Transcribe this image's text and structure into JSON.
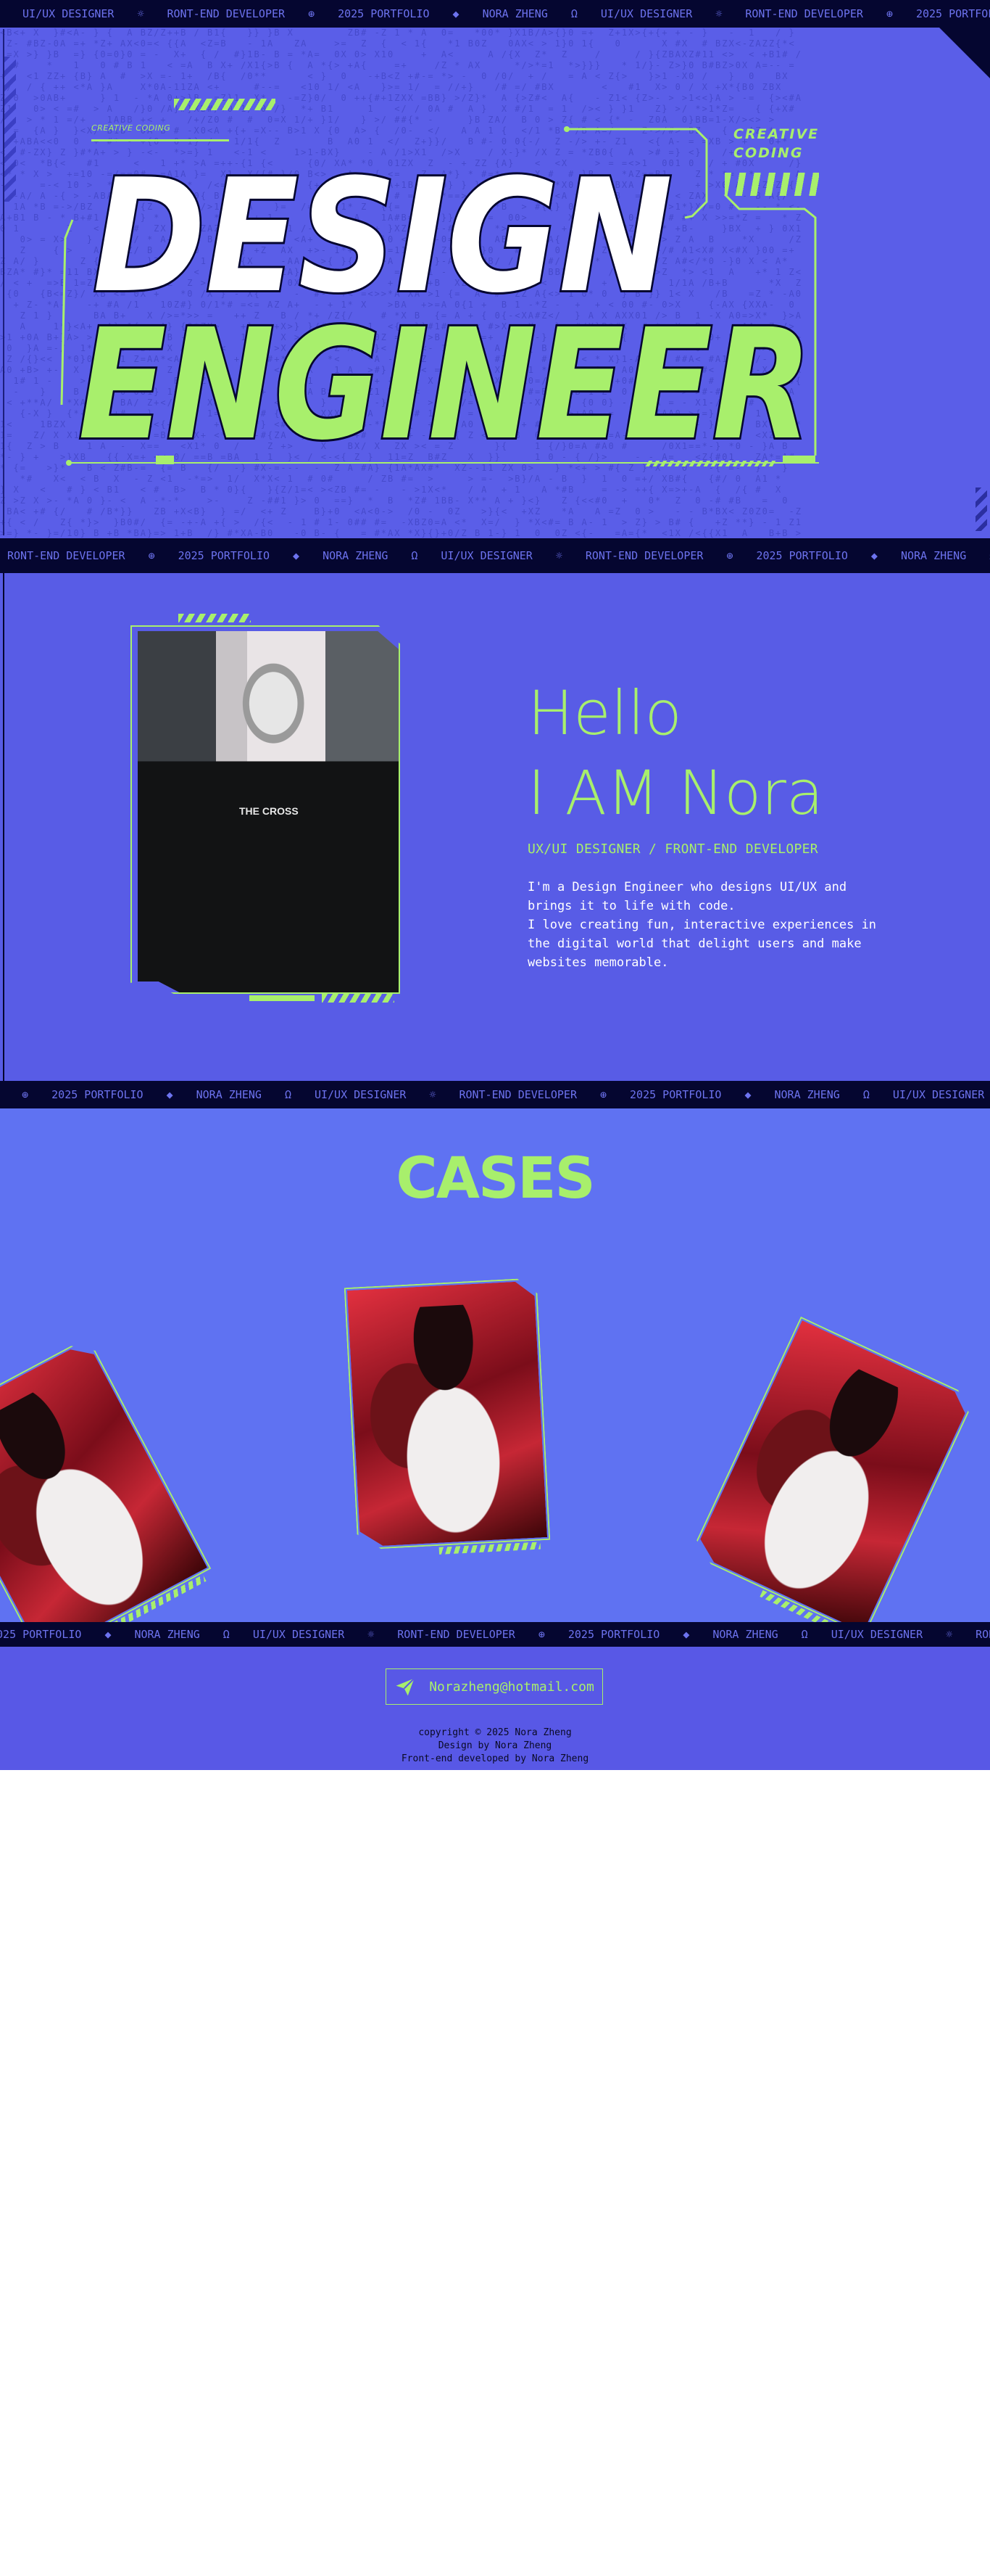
{
  "ticker": {
    "items": [
      {
        "label": "UI/UX DESIGNER",
        "sep": "☼"
      },
      {
        "label": "RONT-END DEVELOPER",
        "sep": "⊕"
      },
      {
        "label": "2025 PORTFOLIO",
        "sep": "◆"
      },
      {
        "label": "NORA ZHENG",
        "sep": "Ω"
      }
    ]
  },
  "hero": {
    "creative_small": "CREATIVE CODING",
    "creative_big_line1": "CREATIVE",
    "creative_big_line2": "CODING",
    "headline_line1": "DESIGN",
    "headline_line2": "ENGINEER"
  },
  "about": {
    "hello": "Hello",
    "intro": "I AM Nora",
    "role": "UX/UI DESIGNER / FRONT-END DEVELOPER",
    "bio_lines": [
      "I'm a Design Engineer who designs UI/UX and",
      "brings it to life with code.",
      "I love creating fun, interactive experiences in",
      "the digital world that delight users and make",
      "websites memorable."
    ],
    "jacket_text": "THE CROSS"
  },
  "cases": {
    "title": "CASES"
  },
  "contact": {
    "email": "Norazheng@hotmail.com",
    "copyright": "copyright © 2025 Nora Zheng",
    "design_credit": "Design by Nora Zheng",
    "dev_credit": "Front-end developed by Nora Zheng"
  },
  "colors": {
    "accent": "#a8ef6c",
    "hero_bg": "#5a5ee8",
    "about_bg": "#585ce6",
    "cases_bg": "#5f72f2",
    "band_bg": "#050630",
    "band_text": "#6d73ef"
  },
  "icons": {
    "send": "paper-plane-icon"
  }
}
